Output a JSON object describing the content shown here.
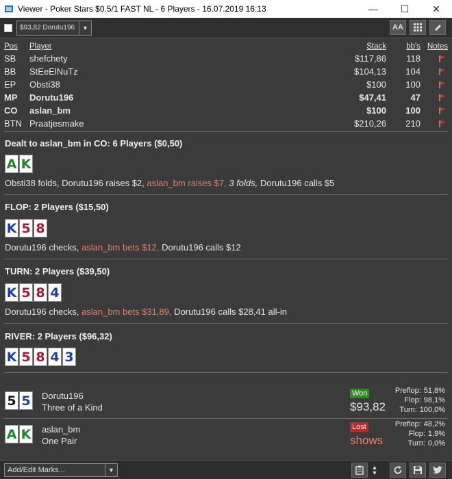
{
  "window": {
    "title": "Viewer - Poker Stars $0.5/1 FAST NL - 6 Players - 16.07.2019 16:13"
  },
  "toolbar": {
    "player_select": "$93,82 Dorutu196",
    "btn_font": "AA"
  },
  "table": {
    "headers": {
      "pos": "Pos",
      "player": "Player",
      "stack": "Stack",
      "bbs": "bb's",
      "notes": "Notes"
    },
    "rows": [
      {
        "pos": "SB",
        "player": "shefchety",
        "stack": "$117,86",
        "bbs": "118",
        "bold": false
      },
      {
        "pos": "BB",
        "player": "StEeElNuTz",
        "stack": "$104,13",
        "bbs": "104",
        "bold": false
      },
      {
        "pos": "EP",
        "player": "Obsti38",
        "stack": "$100",
        "bbs": "100",
        "bold": false
      },
      {
        "pos": "MP",
        "player": "Dorutu196",
        "stack": "$47,41",
        "bbs": "47",
        "bold": true
      },
      {
        "pos": "CO",
        "player": "aslan_bm",
        "stack": "$100",
        "bbs": "100",
        "bold": true
      },
      {
        "pos": "BTN",
        "player": "Praatjesmake",
        "stack": "$210,26",
        "bbs": "210",
        "bold": false
      }
    ]
  },
  "preflop": {
    "title": "Dealt to aslan_bm in CO: 6 Players ($0,50)",
    "cards": [
      {
        "rank": "A",
        "suit": "c"
      },
      {
        "rank": "K",
        "suit": "c"
      }
    ],
    "action": [
      {
        "text": "Obsti38 folds, Dorutu196 raises $2, ",
        "style": "normal"
      },
      {
        "text": "aslan_bm raises $7,",
        "style": "hero"
      },
      {
        "text": " 3 folds,",
        "style": "em"
      },
      {
        "text": " Dorutu196 calls $5",
        "style": "normal"
      }
    ]
  },
  "flop": {
    "title": "FLOP: 2 Players ($15,50)",
    "cards": [
      {
        "rank": "K",
        "suit": "d"
      },
      {
        "rank": "5",
        "suit": "h"
      },
      {
        "rank": "8",
        "suit": "h"
      }
    ],
    "action": [
      {
        "text": "Dorutu196 checks, ",
        "style": "normal"
      },
      {
        "text": "aslan_bm bets $12,",
        "style": "hero"
      },
      {
        "text": " Dorutu196 calls $12",
        "style": "normal"
      }
    ]
  },
  "turn": {
    "title": "TURN: 2 Players ($39,50)",
    "cards": [
      {
        "rank": "K",
        "suit": "d"
      },
      {
        "rank": "5",
        "suit": "h"
      },
      {
        "rank": "8",
        "suit": "h"
      },
      {
        "rank": "4",
        "suit": "d"
      }
    ],
    "action": [
      {
        "text": "Dorutu196 checks, ",
        "style": "normal"
      },
      {
        "text": "aslan_bm bets $31,89,",
        "style": "hero"
      },
      {
        "text": " Dorutu196 calls $28,41 all-in",
        "style": "normal"
      }
    ]
  },
  "river": {
    "title": "RIVER: 2 Players ($96,32)",
    "cards": [
      {
        "rank": "K",
        "suit": "d"
      },
      {
        "rank": "5",
        "suit": "h"
      },
      {
        "rank": "8",
        "suit": "h"
      },
      {
        "rank": "4",
        "suit": "d"
      },
      {
        "rank": "3",
        "suit": "d"
      }
    ]
  },
  "results": [
    {
      "cards": [
        {
          "rank": "5",
          "suit": "s"
        },
        {
          "rank": "5",
          "suit": "d"
        }
      ],
      "name": "Dorutu196",
      "hand": "Three of a Kind",
      "badge": "Won",
      "amount": "$93,82",
      "stats": [
        {
          "label": "Preflop:",
          "value": "51,8%"
        },
        {
          "label": "Flop:",
          "value": "98,1%"
        },
        {
          "label": "Turn:",
          "value": "100,0%"
        }
      ]
    },
    {
      "cards": [
        {
          "rank": "A",
          "suit": "c"
        },
        {
          "rank": "K",
          "suit": "c"
        }
      ],
      "name": "aslan_bm",
      "hand": "One Pair",
      "badge": "Lost",
      "amount": "shows",
      "stats": [
        {
          "label": "Preflop:",
          "value": "48,2%"
        },
        {
          "label": "Flop:",
          "value": "1,9%"
        },
        {
          "label": "Turn:",
          "value": "0,0%"
        }
      ]
    }
  ],
  "bottombar": {
    "marks_placeholder": "Add/Edit Marks..."
  },
  "colors": {
    "hero_action": "#e57f6c",
    "won": "#2f8a22",
    "lost": "#c0272d",
    "flag": "#d23a1e"
  }
}
